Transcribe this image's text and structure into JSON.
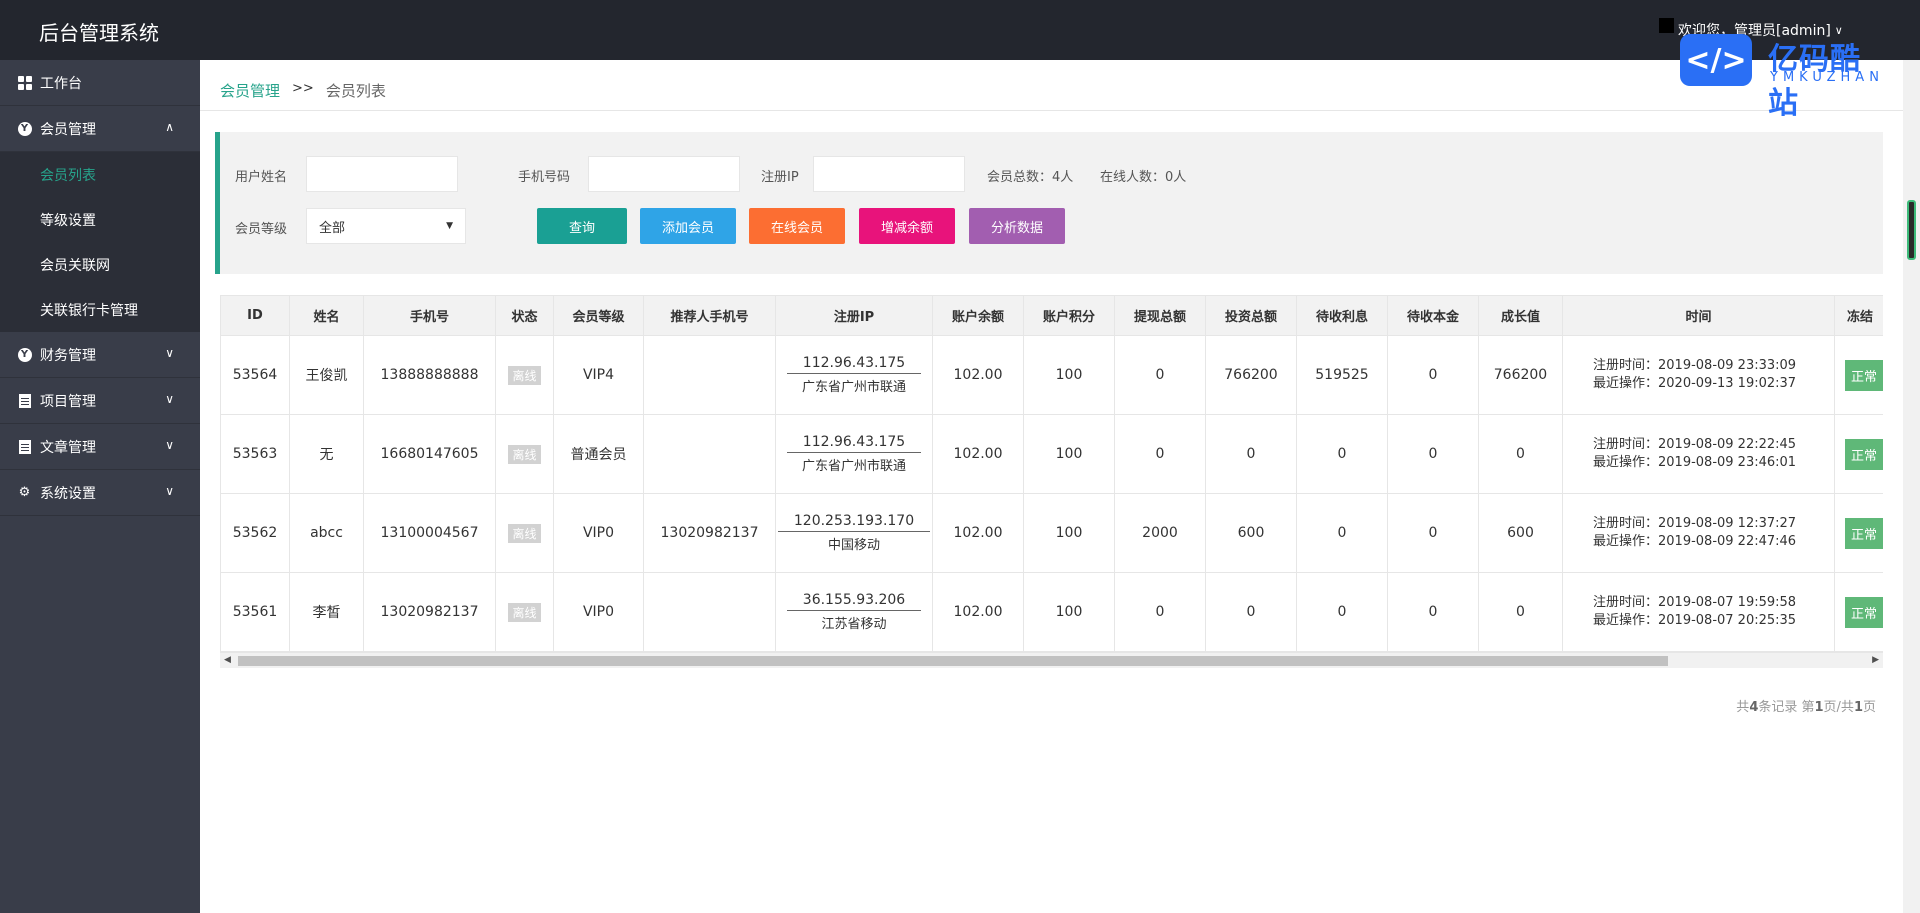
{
  "header": {
    "title": "后台管理系统",
    "welcome": "欢迎您，管理员[admin]"
  },
  "logo": {
    "cn": "亿码酷站",
    "en": "YMKUZHAN",
    "color": "#2a6ff5"
  },
  "sidebar": {
    "items": [
      {
        "icon": "dashboard-icon",
        "label": "工作台"
      },
      {
        "icon": "member-icon",
        "label": "会员管理",
        "expanded": true,
        "children": [
          "会员列表",
          "等级设置",
          "会员关联网",
          "关联银行卡管理"
        ]
      },
      {
        "icon": "finance-icon",
        "label": "财务管理"
      },
      {
        "icon": "project-icon",
        "label": "项目管理"
      },
      {
        "icon": "article-icon",
        "label": "文章管理"
      },
      {
        "icon": "settings-icon",
        "label": "系统设置"
      }
    ],
    "active_child": "会员列表"
  },
  "breadcrumb": {
    "parent": "会员管理",
    "separator": ">>",
    "current": "会员列表"
  },
  "filter": {
    "username_label": "用户姓名",
    "username_value": "",
    "phone_label": "手机号码",
    "phone_value": "",
    "ip_label": "注册IP",
    "ip_value": "",
    "total_members": "会员总数：4人",
    "online_count": "在线人数：0人",
    "level_label": "会员等级",
    "level_value": "全部",
    "buttons": {
      "search": "查询",
      "add": "添加会员",
      "online": "在线会员",
      "balance": "增减余额",
      "analyze": "分析数据"
    }
  },
  "table": {
    "columns": [
      "ID",
      "姓名",
      "手机号",
      "状态",
      "会员等级",
      "推荐人手机号",
      "注册IP",
      "账户余额",
      "账户积分",
      "提现总额",
      "投资总额",
      "待收利息",
      "待收本金",
      "成长值",
      "时间",
      "冻结"
    ],
    "rows": [
      {
        "id": "53564",
        "name": "王俊凯",
        "phone": "13888888888",
        "status": "离线",
        "level": "VIP4",
        "referrer": "",
        "ip": "112.96.43.175",
        "ip_loc": "广东省广州市联通",
        "balance": "102.00",
        "points": "100",
        "withdraw": "0",
        "invest": "766200",
        "interest": "519525",
        "principal": "0",
        "growth": "766200",
        "reg_time": "注册时间：2019-08-09 23:33:09",
        "last_op": "最近操作：2020-09-13 19:02:37",
        "freeze": "正常"
      },
      {
        "id": "53563",
        "name": "无",
        "phone": "16680147605",
        "status": "离线",
        "level": "普通会员",
        "referrer": "",
        "ip": "112.96.43.175",
        "ip_loc": "广东省广州市联通",
        "balance": "102.00",
        "points": "100",
        "withdraw": "0",
        "invest": "0",
        "interest": "0",
        "principal": "0",
        "growth": "0",
        "reg_time": "注册时间：2019-08-09 22:22:45",
        "last_op": "最近操作：2019-08-09 23:46:01",
        "freeze": "正常"
      },
      {
        "id": "53562",
        "name": "abcc",
        "phone": "13100004567",
        "status": "离线",
        "level": "VIP0",
        "referrer": "13020982137",
        "ip": "120.253.193.170",
        "ip_loc": "中国移动",
        "balance": "102.00",
        "points": "100",
        "withdraw": "2000",
        "invest": "600",
        "interest": "0",
        "principal": "0",
        "growth": "600",
        "reg_time": "注册时间：2019-08-09 12:37:27",
        "last_op": "最近操作：2019-08-09 22:47:46",
        "freeze": "正常"
      },
      {
        "id": "53561",
        "name": "李皙",
        "phone": "13020982137",
        "status": "离线",
        "level": "VIP0",
        "referrer": "",
        "ip": "36.155.93.206",
        "ip_loc": "江苏省移动",
        "balance": "102.00",
        "points": "100",
        "withdraw": "0",
        "invest": "0",
        "interest": "0",
        "principal": "0",
        "growth": "0",
        "reg_time": "注册时间：2019-08-07 19:59:58",
        "last_op": "最近操作：2019-08-07 20:25:35",
        "freeze": "正常"
      }
    ]
  },
  "pager": {
    "prefix": "共",
    "count": "4",
    "mid": "条记录 第",
    "page": "1",
    "sep": "页/共",
    "total": "1",
    "suffix": "页"
  },
  "colors": {
    "header_bg": "#23262e",
    "sidebar_bg": "#393d49",
    "accent": "#27a38b",
    "btn_search": "#1aa094",
    "btn_add": "#2fa4e7",
    "btn_online": "#fc6e32",
    "btn_balance": "#e8137b",
    "btn_analyze": "#a25eb0",
    "freeze_ok": "#5fb878"
  }
}
